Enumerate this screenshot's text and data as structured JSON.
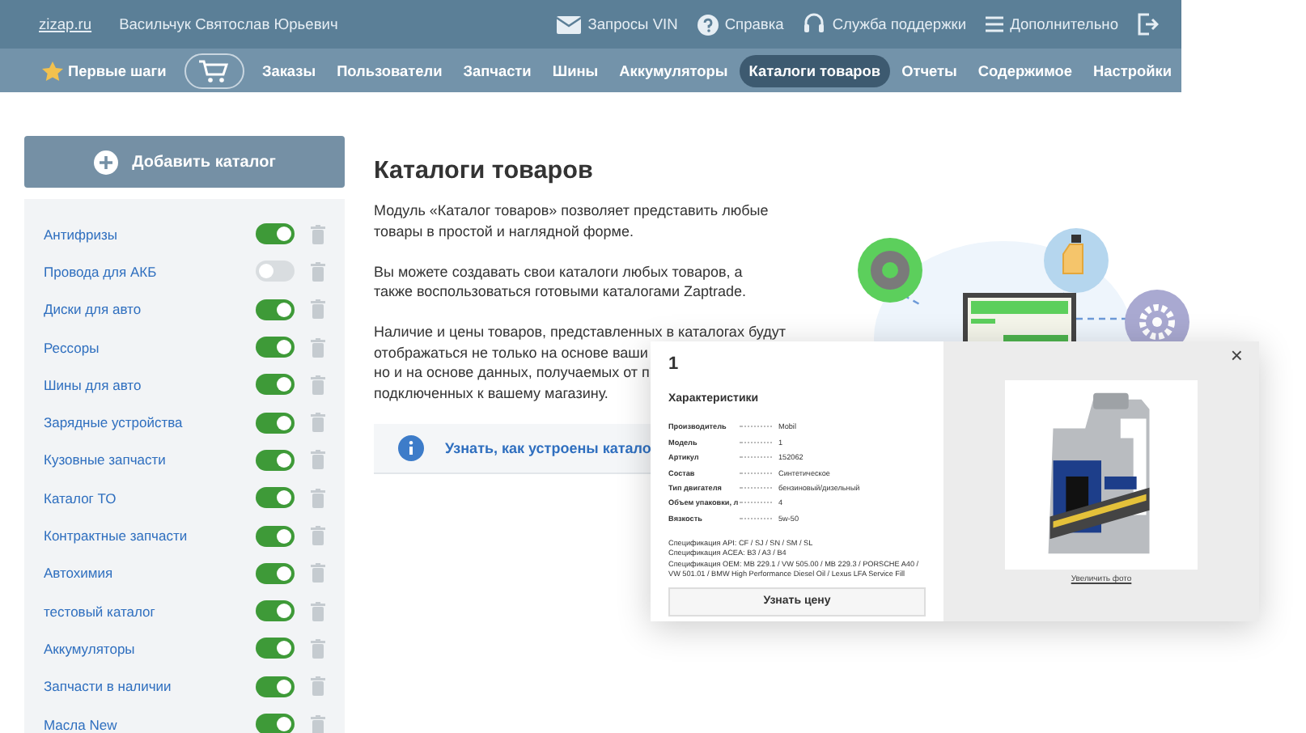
{
  "header": {
    "site_link": "zizap.ru",
    "user_name": "Васильчук Святослав Юрьевич",
    "links": [
      {
        "kind": "mail",
        "label": "Запросы VIN"
      },
      {
        "kind": "help",
        "label": "Справка"
      },
      {
        "kind": "support",
        "label": "Служба поддержки"
      },
      {
        "kind": "menu",
        "label": "Дополнительно"
      },
      {
        "kind": "exit"
      }
    ]
  },
  "nav": [
    {
      "kind": "star",
      "label": "Первые шаги",
      "selected": false
    },
    {
      "kind": "cart",
      "selected": false
    },
    {
      "label": "Заказы",
      "selected": false
    },
    {
      "label": "Пользователи",
      "selected": false
    },
    {
      "label": "Запчасти",
      "selected": false
    },
    {
      "label": "Шины",
      "selected": false
    },
    {
      "label": "Аккумуляторы",
      "selected": false
    },
    {
      "label": "Каталоги товаров",
      "selected": true
    },
    {
      "label": "Отчеты",
      "selected": false
    },
    {
      "label": "Содержимое",
      "selected": false
    },
    {
      "label": "Настройки",
      "selected": false
    }
  ],
  "sidebar": {
    "add_button": "Добавить каталог",
    "catalogs": [
      {
        "name": "Антифризы",
        "on": true
      },
      {
        "name": "Провода для АКБ",
        "on": false
      },
      {
        "name": "Диски для авто",
        "on": true
      },
      {
        "name": "Рессоры",
        "on": true
      },
      {
        "name": "Шины для авто",
        "on": true
      },
      {
        "name": "Зарядные устройства",
        "on": true
      },
      {
        "name": "Кузовные запчасти",
        "on": true
      },
      {
        "name": "Каталог ТО",
        "on": true
      },
      {
        "name": "Контрактные запчасти",
        "on": true
      },
      {
        "name": "Автохимия",
        "on": true
      },
      {
        "name": "тестовый каталог",
        "on": true
      },
      {
        "name": "Аккумуляторы",
        "on": true
      },
      {
        "name": "Запчасти в наличии",
        "on": true
      },
      {
        "name": "Масла New",
        "on": true
      }
    ]
  },
  "main": {
    "title": "Каталоги товаров",
    "paragraphs": [
      [
        "Модуль «Каталог товаров» позволяет представить любые",
        "товары в простой и наглядной форме."
      ],
      [
        "Вы можете создавать свои каталоги любых товаров, а",
        "также воспользоваться готовыми каталогами Zaptrade."
      ],
      [
        "Наличие и цены товаров, представленных в каталогах будут",
        "отображаться не только на основе ваши",
        "но и на основе данных, получаемых от п",
        "подключенных к вашему магазину."
      ]
    ],
    "info_link": "Узнать, как устроены катало"
  },
  "popup": {
    "title": "1",
    "section": "Характеристики",
    "specs": [
      {
        "label": "Производитель",
        "value": "Mobil"
      },
      {
        "label": "Модель",
        "value": "1"
      },
      {
        "label": "Артикул",
        "value": "152062"
      },
      {
        "label": "Состав",
        "value": "Синтетическое"
      },
      {
        "label": "Тип двигателя",
        "value": "бензиновый/дизельный"
      },
      {
        "label": "Объем упаковки, л",
        "value": "4"
      },
      {
        "label": "Вязкость",
        "value": "5w-50"
      }
    ],
    "notes": [
      "Спецификация API: CF / SJ / SN / SM / SL",
      "Спецификация ACEA: B3 / A3 / B4",
      "Спецификация OEM: MB 229.1 / VW 505.00 / MB 229.3 / PORSCHE A40 / VW 501.01 / BMW High Performance Diesel Oil / Lexus LFA Service Fill"
    ],
    "price_button": "Узнать цену",
    "close": "×",
    "zoom_link": "Увеличить фото",
    "photo": {
      "kind": "picture"
    }
  }
}
